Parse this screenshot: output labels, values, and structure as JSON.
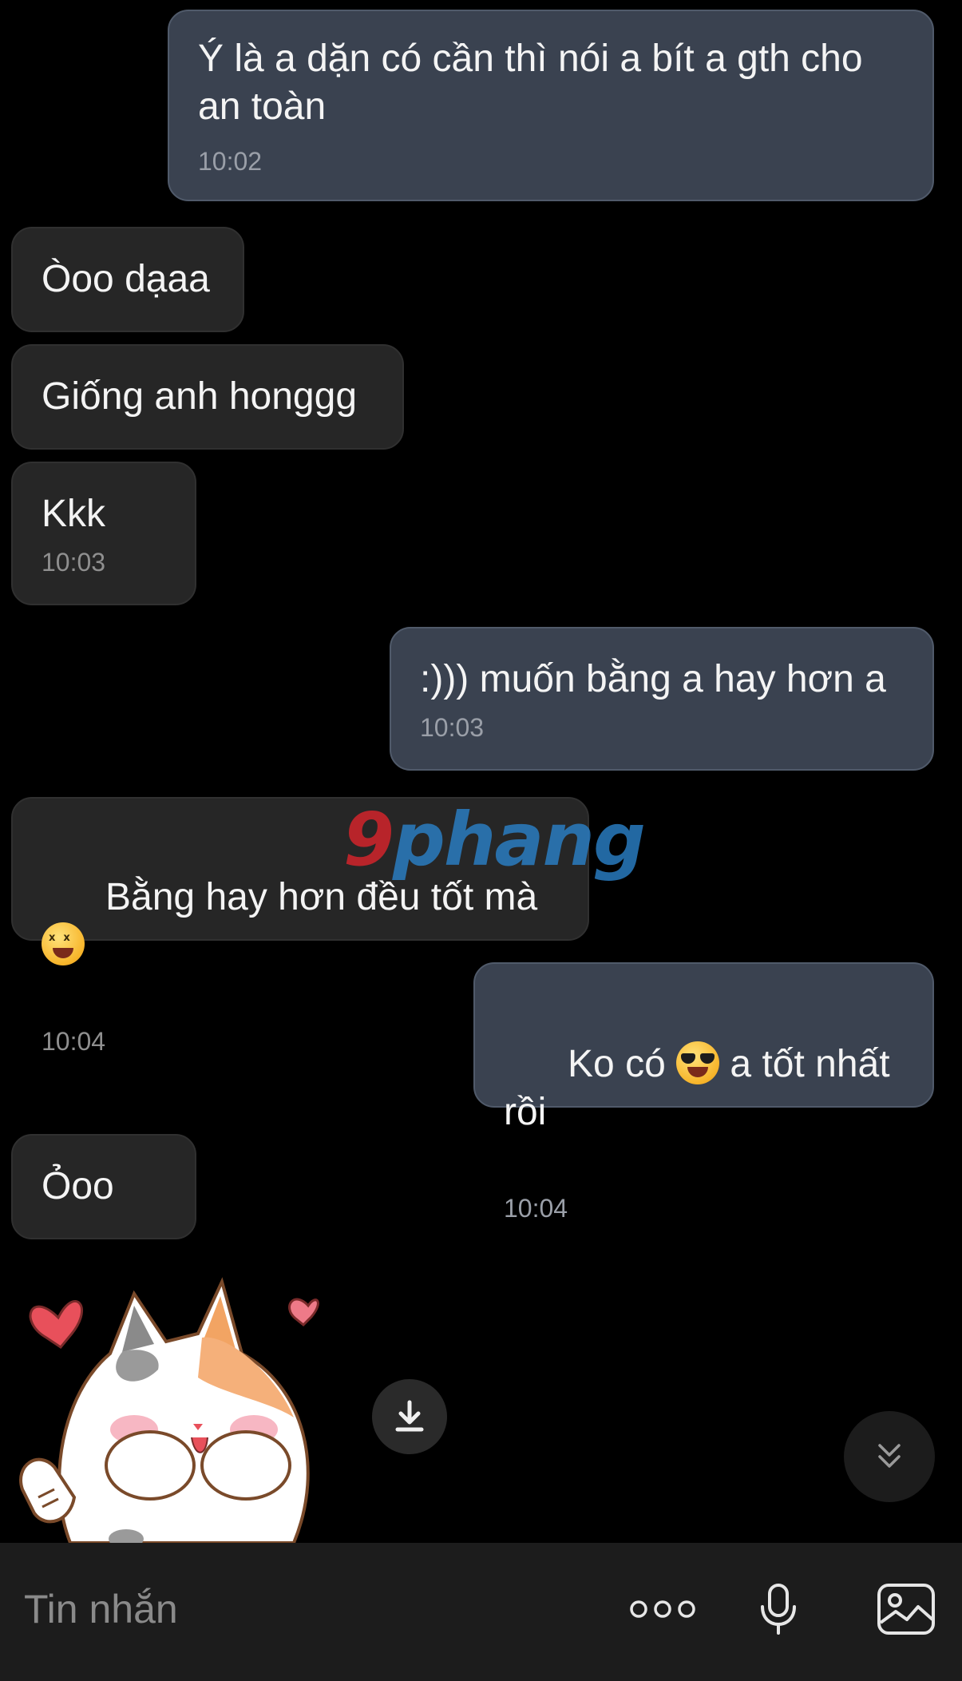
{
  "messages": [
    {
      "direction": "out",
      "text": "Ý là a dặn có cần thì nói a bít a gth cho\nan toàn",
      "time": "10:02"
    },
    {
      "direction": "in",
      "text": "Òoo dạaa",
      "time": ""
    },
    {
      "direction": "in",
      "text": "Giống anh honggg",
      "time": ""
    },
    {
      "direction": "in",
      "text": "Kkk",
      "time": "10:03"
    },
    {
      "direction": "out",
      "text": ":))) muốn bằng a hay hơn a",
      "time": "10:03"
    },
    {
      "direction": "in",
      "text_before": "Bằng hay hơn đều tốt mà ",
      "emoji": "laughing-face-icon",
      "time": "10:04"
    },
    {
      "direction": "out",
      "text_before": "Ko có ",
      "emoji": "sunglasses-face-icon",
      "text_after": " a tốt nhất rồi",
      "time": "10:04"
    },
    {
      "direction": "in",
      "text": "Ỏoo",
      "time": ""
    }
  ],
  "watermark": {
    "part1": "9",
    "part2": "phang"
  },
  "sticker": {
    "icon": "shy-cat-sticker-icon"
  },
  "composer": {
    "placeholder": "Tin nhắn",
    "more_icon": "more-dots-icon",
    "mic_icon": "microphone-icon",
    "image_icon": "image-icon"
  },
  "colors": {
    "background": "#000000",
    "outgoing_bubble": "#3a4250",
    "incoming_bubble": "#262626",
    "composer_bar": "#1c1c1c"
  }
}
